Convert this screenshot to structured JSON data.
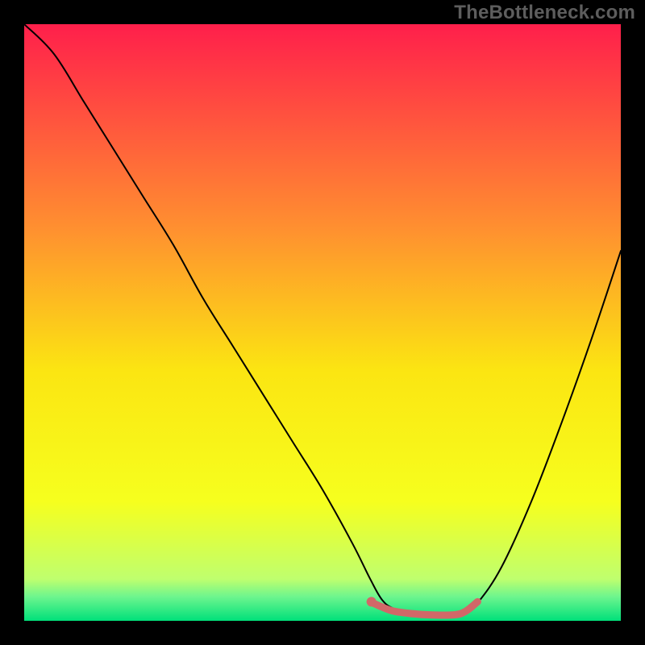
{
  "watermark": "TheBottleneck.com",
  "chart_data": {
    "type": "line",
    "title": "",
    "xlabel": "",
    "ylabel": "",
    "xlim": [
      0,
      100
    ],
    "ylim": [
      0,
      100
    ],
    "grid": false,
    "legend": false,
    "background_gradient": {
      "direction": "vertical",
      "stops": [
        {
          "offset": 0.0,
          "color": "#ff1f4b"
        },
        {
          "offset": 0.34,
          "color": "#ff8f30"
        },
        {
          "offset": 0.58,
          "color": "#fbe512"
        },
        {
          "offset": 0.8,
          "color": "#f6ff1e"
        },
        {
          "offset": 0.93,
          "color": "#bfff6e"
        },
        {
          "offset": 0.96,
          "color": "#6cf58e"
        },
        {
          "offset": 1.0,
          "color": "#00e07a"
        }
      ]
    },
    "series": [
      {
        "name": "bottleneck-curve",
        "color": "#000000",
        "stroke_width": 2,
        "x": [
          0,
          5,
          10,
          15,
          20,
          25,
          30,
          35,
          40,
          45,
          50,
          55,
          58,
          60,
          62,
          65,
          68,
          72,
          74,
          76,
          80,
          85,
          90,
          95,
          100
        ],
        "y": [
          100,
          95,
          87,
          79,
          71,
          63,
          54,
          46,
          38,
          30,
          22,
          13,
          7,
          3.5,
          2,
          1.2,
          1.0,
          1.0,
          1.5,
          3,
          9,
          20,
          33,
          47,
          62
        ]
      },
      {
        "name": "optimal-range-highlight",
        "color": "#d16868",
        "stroke_width": 9,
        "x": [
          58,
          60,
          62,
          65,
          68,
          72,
          74,
          76
        ],
        "y": [
          3.2,
          2.3,
          1.6,
          1.2,
          1.0,
          1.0,
          1.6,
          3.2
        ]
      }
    ],
    "markers": [
      {
        "name": "optimal-start-dot",
        "x": 58.2,
        "y": 3.2,
        "r": 6,
        "color": "#d16868"
      }
    ]
  }
}
